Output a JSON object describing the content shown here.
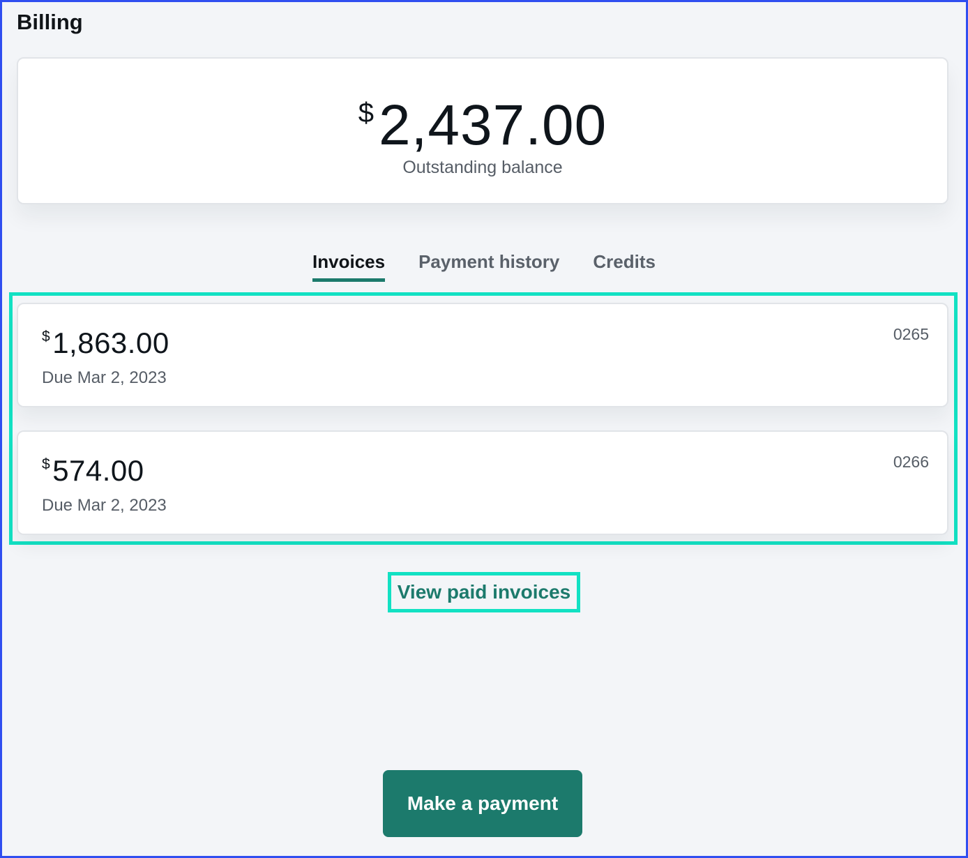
{
  "header": {
    "title": "Billing"
  },
  "balance": {
    "currency_symbol": "$",
    "amount": "2,437.00",
    "label": "Outstanding balance"
  },
  "tabs": [
    {
      "label": "Invoices",
      "active": true
    },
    {
      "label": "Payment history",
      "active": false
    },
    {
      "label": "Credits",
      "active": false
    }
  ],
  "invoices": [
    {
      "currency_symbol": "$",
      "amount": "1,863.00",
      "due": "Due Mar 2, 2023",
      "number": "0265"
    },
    {
      "currency_symbol": "$",
      "amount": "574.00",
      "due": "Due Mar 2, 2023",
      "number": "0266"
    }
  ],
  "links": {
    "view_paid": "View paid invoices"
  },
  "actions": {
    "make_payment": "Make a payment"
  },
  "colors": {
    "accent": "#1c7a6c",
    "highlight": "#12e1c3",
    "frame": "#2f4ef0",
    "background": "#f3f5f8"
  }
}
